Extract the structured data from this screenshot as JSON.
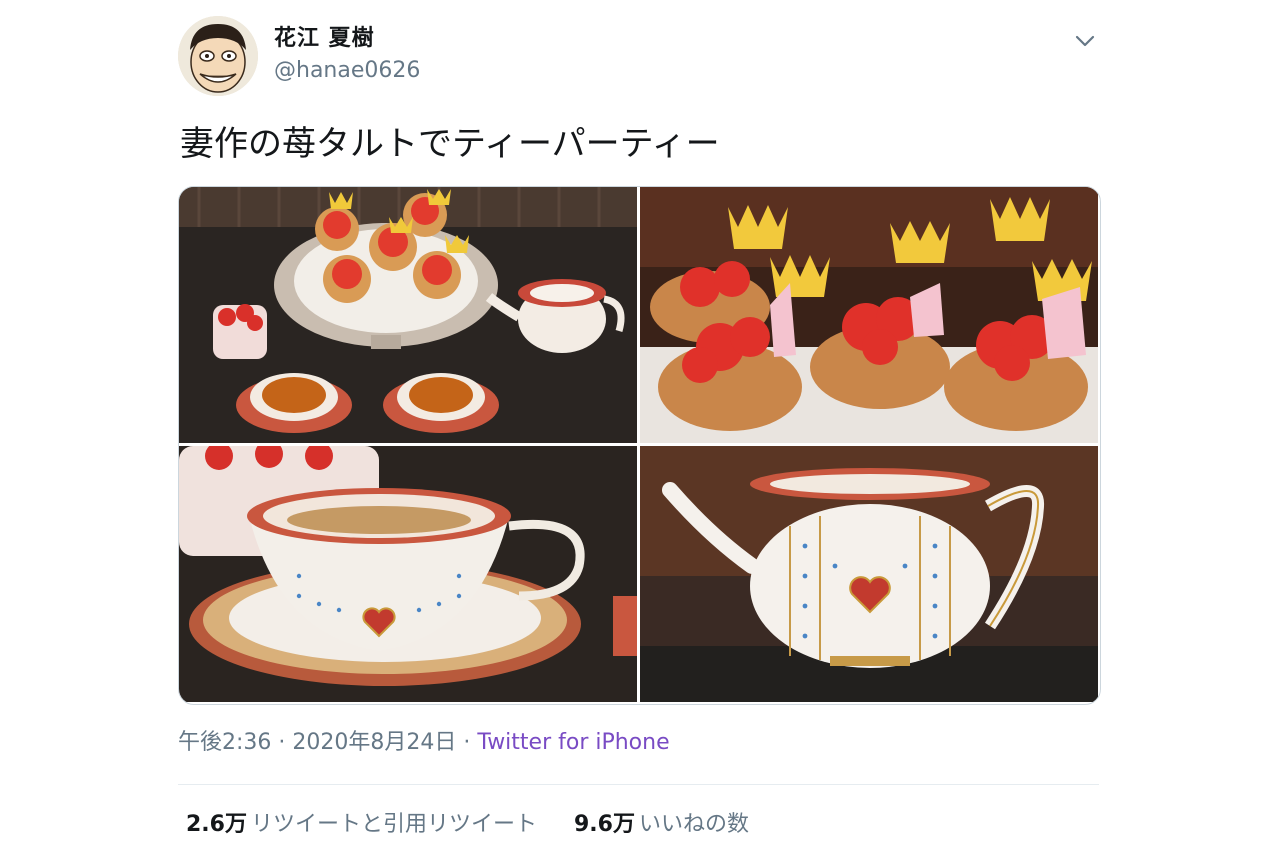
{
  "author": {
    "display_name": "花江 夏樹",
    "handle": "@hanae0626"
  },
  "tweet": {
    "text": "妻作の苺タルトでティーパーティー"
  },
  "media": {
    "photos": [
      {
        "subject": "tea-party-table"
      },
      {
        "subject": "strawberry-tarts-closeup"
      },
      {
        "subject": "teacup-and-saucer"
      },
      {
        "subject": "teapot"
      }
    ]
  },
  "meta": {
    "time": "午後2:36",
    "date": "2020年8月24日",
    "separator": "·",
    "source": "Twitter for iPhone"
  },
  "stats": {
    "retweets_count": "2.6万",
    "retweets_label": "リツイートと引用リツイート",
    "likes_count": "9.6万",
    "likes_label": "いいねの数"
  },
  "colors": {
    "link": "#794bc4",
    "secondary_text": "#657786",
    "primary_text": "#14171a",
    "divider": "#e6ecf0"
  },
  "icons": {
    "caret": "chevron-down-icon"
  }
}
